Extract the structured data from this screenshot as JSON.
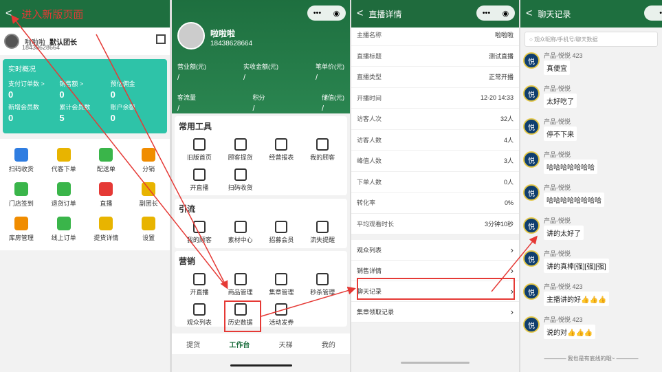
{
  "annotation": {
    "title": "进入新版页面"
  },
  "p1": {
    "user": {
      "name": "啦啦啦",
      "role": "默认团长",
      "phone": "18438628664"
    },
    "overview": {
      "title": "实时概况",
      "stats": [
        {
          "label": "支付订单数 >",
          "value": "0"
        },
        {
          "label": "销售额 >",
          "value": "0"
        },
        {
          "label": "预估佣金",
          "value": "0"
        },
        {
          "label": "新增会员数",
          "value": "0"
        },
        {
          "label": "累计会员数",
          "value": "5"
        },
        {
          "label": "账户余额",
          "value": "0"
        }
      ]
    },
    "icons": [
      {
        "label": "扫码收货",
        "color": "#2f7de1",
        "icon": "scan-icon"
      },
      {
        "label": "代客下单",
        "color": "#e8b400",
        "icon": "order-icon"
      },
      {
        "label": "配送单",
        "color": "#3ab54a",
        "icon": "delivery-icon"
      },
      {
        "label": "分销",
        "color": "#f08c00",
        "icon": "money-icon"
      },
      {
        "label": "门店签到",
        "color": "#3ab54a",
        "icon": "tag-icon"
      },
      {
        "label": "退货订单",
        "color": "#3ab54a",
        "icon": "return-icon"
      },
      {
        "label": "直播",
        "color": "#e53935",
        "icon": "live-icon"
      },
      {
        "label": "副团长",
        "color": "#e8b400",
        "icon": "medal-icon"
      },
      {
        "label": "库房管理",
        "color": "#f08c00",
        "icon": "house-icon"
      },
      {
        "label": "线上订单",
        "color": "#3ab54a",
        "icon": "doc-icon"
      },
      {
        "label": "提货详情",
        "color": "#e8b400",
        "icon": "detail-icon"
      },
      {
        "label": "设置",
        "color": "#e8b400",
        "icon": "gear-icon"
      }
    ]
  },
  "p2": {
    "user": {
      "name": "啦啦啦",
      "phone": "18438628664"
    },
    "stats1": [
      {
        "label": "营业额(元)",
        "value": "/"
      },
      {
        "label": "实收金额(元)",
        "value": "/"
      },
      {
        "label": "笔单价(元)",
        "value": "/"
      }
    ],
    "stats2": [
      {
        "label": "客流量",
        "value": "/"
      },
      {
        "label": "积分",
        "value": "/"
      },
      {
        "label": "储值(元)",
        "value": "/"
      }
    ],
    "tools": {
      "title": "常用工具",
      "items": [
        "旧版首页",
        "顾客提货",
        "经营报表",
        "我的顾客",
        "开直播",
        "扫码收货"
      ]
    },
    "traffic": {
      "title": "引流",
      "items": [
        "我的顾客",
        "素材中心",
        "招募会员",
        "流失提醒"
      ]
    },
    "marketing": {
      "title": "营销",
      "items": [
        "开直播",
        "商品管理",
        "集章管理",
        "秒杀管理",
        "观众列表",
        "历史数据",
        "活动发券"
      ]
    },
    "tabs": [
      "提货",
      "工作台",
      "天梯",
      "我的"
    ]
  },
  "p3": {
    "title": "直播详情",
    "rows": [
      {
        "label": "主播名称",
        "value": "啦啦啦"
      },
      {
        "label": "直播标题",
        "value": "测试直播"
      },
      {
        "label": "直播类型",
        "value": "正常开播"
      },
      {
        "label": "开播时间",
        "value": "12-20 14:33"
      },
      {
        "label": "访客人次",
        "value": "32人"
      },
      {
        "label": "访客人数",
        "value": "4人"
      },
      {
        "label": "峰值人数",
        "value": "3人"
      },
      {
        "label": "下单人数",
        "value": "0人"
      },
      {
        "label": "转化率",
        "value": "0%"
      },
      {
        "label": "平均观看时长",
        "value": "3分钟10秒"
      }
    ],
    "links": [
      "观众列表",
      "销售详情",
      "聊天记录",
      "集章领取记录"
    ]
  },
  "p4": {
    "title": "聊天记录",
    "search_placeholder": "观众昵称/手机号/聊天数据",
    "avatar_char": "悦",
    "messages": [
      {
        "sender": "产品-悦悦 423",
        "text": "真便宜"
      },
      {
        "sender": "产品-悦悦",
        "text": "太好吃了"
      },
      {
        "sender": "产品-悦悦",
        "text": "停不下来"
      },
      {
        "sender": "产品-悦悦",
        "text": "哈哈哈哈哈哈哈"
      },
      {
        "sender": "产品-悦悦",
        "text": "哈哈哈哈哈哈哈哈"
      },
      {
        "sender": "产品-悦悦",
        "text": "讲的太好了"
      },
      {
        "sender": "产品-悦悦",
        "text": "讲的真棒[强][强][强]"
      },
      {
        "sender": "产品-悦悦 423",
        "text": "主播讲的好👍👍👍"
      },
      {
        "sender": "产品-悦悦 423",
        "text": "说的对👍👍👍"
      }
    ],
    "footer": "———— 我也是有底线的哦~ ————"
  },
  "colors": {
    "brand": "#1e6f3f",
    "teal": "#2ec3a8",
    "annotation": "#e53935"
  }
}
